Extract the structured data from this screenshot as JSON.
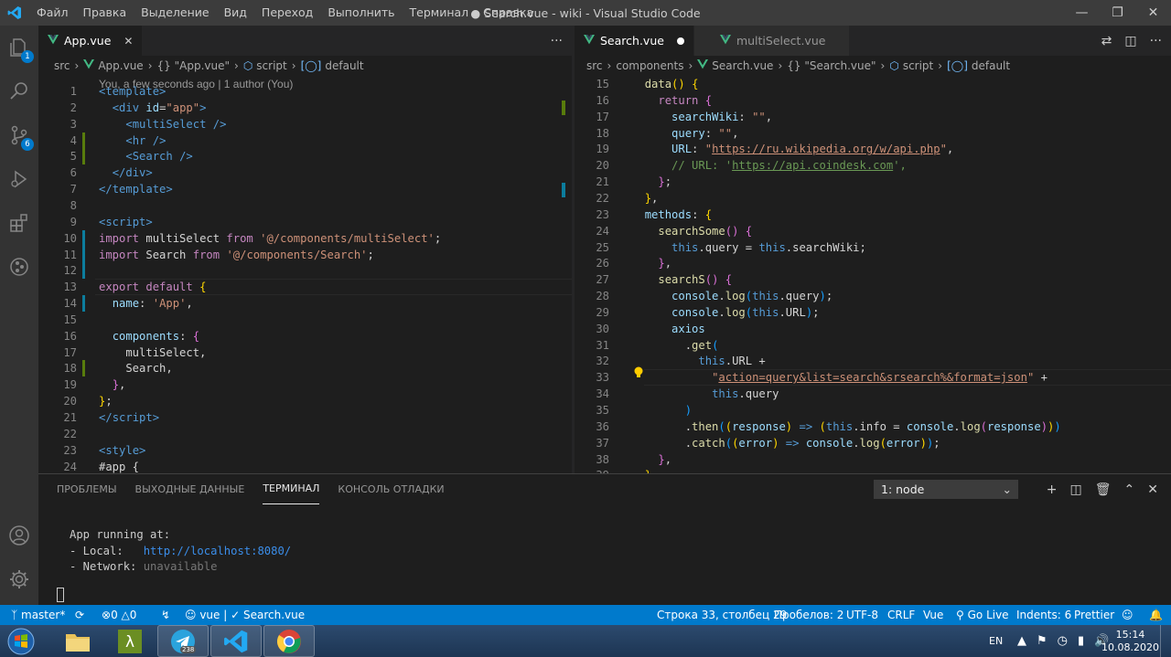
{
  "window": {
    "title": "● Search.vue - wiki - Visual Studio Code",
    "menu": [
      "Файл",
      "Правка",
      "Выделение",
      "Вид",
      "Переход",
      "Выполнить",
      "Терминал",
      "Справка"
    ]
  },
  "activitybar": {
    "explorer_badge": "1",
    "scm_badge": "6"
  },
  "left_editor": {
    "tab": {
      "label": "App.vue"
    },
    "breadcrumb": [
      "src",
      "App.vue",
      "{} \"App.vue\"",
      "script",
      "default"
    ],
    "codelens": "You, a few seconds ago | 1 author (You)",
    "line_numbers": [
      "1",
      "2",
      "3",
      "4",
      "5",
      "6",
      "7",
      "8",
      "9",
      "10",
      "11",
      "12",
      "13",
      "14",
      "15",
      "16",
      "17",
      "18",
      "19",
      "20",
      "21",
      "22",
      "23",
      "24"
    ],
    "lines": [
      [
        [
          "tg",
          "<"
        ],
        [
          "tg",
          "template"
        ],
        [
          "tg",
          ">"
        ]
      ],
      [
        [
          "tx",
          "  "
        ],
        [
          "tg",
          "<"
        ],
        [
          "tg",
          "div"
        ],
        [
          "tx",
          " "
        ],
        [
          "at",
          "id"
        ],
        [
          "tx",
          "="
        ],
        [
          "st",
          "\"app\""
        ],
        [
          "tg",
          ">"
        ]
      ],
      [
        [
          "tx",
          "    "
        ],
        [
          "tg",
          "<"
        ],
        [
          "tg",
          "multiSelect"
        ],
        [
          "tx",
          " "
        ],
        [
          "tg",
          "/>"
        ]
      ],
      [
        [
          "tx",
          "    "
        ],
        [
          "tg",
          "<"
        ],
        [
          "tg",
          "hr"
        ],
        [
          "tx",
          " "
        ],
        [
          "tg",
          "/>"
        ]
      ],
      [
        [
          "tx",
          "    "
        ],
        [
          "tg",
          "<"
        ],
        [
          "tg",
          "Search"
        ],
        [
          "tx",
          " "
        ],
        [
          "tg",
          "/>"
        ]
      ],
      [
        [
          "tx",
          "  "
        ],
        [
          "tg",
          "</"
        ],
        [
          "tg",
          "div"
        ],
        [
          "tg",
          ">"
        ]
      ],
      [
        [
          "tg",
          "</"
        ],
        [
          "tg",
          "template"
        ],
        [
          "tg",
          ">"
        ]
      ],
      [],
      [
        [
          "tg",
          "<"
        ],
        [
          "tg",
          "script"
        ],
        [
          "tg",
          ">"
        ]
      ],
      [
        [
          "kw",
          "import"
        ],
        [
          "tx",
          " multiSelect "
        ],
        [
          "kw",
          "from"
        ],
        [
          "tx",
          " "
        ],
        [
          "st",
          "'@/components/multiSelect'"
        ],
        [
          "tx",
          ";"
        ]
      ],
      [
        [
          "kw",
          "import"
        ],
        [
          "tx",
          " Search "
        ],
        [
          "kw",
          "from"
        ],
        [
          "tx",
          " "
        ],
        [
          "st",
          "'@/components/Search'"
        ],
        [
          "tx",
          ";"
        ]
      ],
      [],
      [
        [
          "kw",
          "export"
        ],
        [
          "tx",
          " "
        ],
        [
          "kw",
          "default"
        ],
        [
          "tx",
          " "
        ],
        [
          "gd",
          "{"
        ]
      ],
      [
        [
          "tx",
          "  "
        ],
        [
          "vr",
          "name"
        ],
        [
          "tx",
          ": "
        ],
        [
          "st",
          "'App'"
        ],
        [
          "tx",
          ","
        ]
      ],
      [],
      [
        [
          "tx",
          "  "
        ],
        [
          "vr",
          "components"
        ],
        [
          "tx",
          ": "
        ],
        [
          "pk",
          "{"
        ]
      ],
      [
        [
          "tx",
          "    multiSelect,"
        ]
      ],
      [
        [
          "tx",
          "    Search,"
        ]
      ],
      [
        [
          "tx",
          "  "
        ],
        [
          "pk",
          "}"
        ],
        [
          "tx",
          ","
        ]
      ],
      [
        [
          "gd",
          "}"
        ],
        [
          "tx",
          ";"
        ]
      ],
      [
        [
          "tg",
          "</"
        ],
        [
          "tg",
          "script"
        ],
        [
          "tg",
          ">"
        ]
      ],
      [],
      [
        [
          "tg",
          "<"
        ],
        [
          "tg",
          "style"
        ],
        [
          "tg",
          ">"
        ]
      ],
      [
        [
          "tx",
          "#app {"
        ]
      ]
    ]
  },
  "right_editor": {
    "tabs": [
      {
        "label": "Search.vue",
        "dirty": true
      },
      {
        "label": "multiSelect.vue"
      }
    ],
    "breadcrumb": [
      "src",
      "components",
      "Search.vue",
      "{} \"Search.vue\"",
      "script",
      "default"
    ],
    "line_numbers": [
      "15",
      "16",
      "17",
      "18",
      "19",
      "20",
      "21",
      "22",
      "23",
      "24",
      "25",
      "26",
      "27",
      "28",
      "29",
      "30",
      "31",
      "32",
      "33",
      "34",
      "35",
      "36",
      "37",
      "38",
      "39"
    ],
    "lines": [
      [
        [
          "tx",
          "  "
        ],
        [
          "fn",
          "data"
        ],
        [
          "gd",
          "()"
        ],
        [
          "tx",
          " "
        ],
        [
          "gd",
          "{"
        ]
      ],
      [
        [
          "tx",
          "    "
        ],
        [
          "kw",
          "return"
        ],
        [
          "tx",
          " "
        ],
        [
          "pk",
          "{"
        ]
      ],
      [
        [
          "tx",
          "      "
        ],
        [
          "vr",
          "searchWiki"
        ],
        [
          "tx",
          ": "
        ],
        [
          "st",
          "\"\""
        ],
        [
          "tx",
          ","
        ]
      ],
      [
        [
          "tx",
          "      "
        ],
        [
          "vr",
          "query"
        ],
        [
          "tx",
          ": "
        ],
        [
          "st",
          "\"\""
        ],
        [
          "tx",
          ","
        ]
      ],
      [
        [
          "tx",
          "      "
        ],
        [
          "vr",
          "URL"
        ],
        [
          "tx",
          ": "
        ],
        [
          "st",
          "\""
        ],
        [
          "stu",
          "https://ru.wikipedia.org/w/api.php"
        ],
        [
          "st",
          "\""
        ],
        [
          "tx",
          ","
        ]
      ],
      [
        [
          "tx",
          "      "
        ],
        [
          "cm",
          "// URL: '"
        ],
        [
          "cmu",
          "https://api.coindesk.com"
        ],
        [
          "cm",
          "',"
        ]
      ],
      [
        [
          "tx",
          "    "
        ],
        [
          "pk",
          "}"
        ],
        [
          "tx",
          ";"
        ]
      ],
      [
        [
          "tx",
          "  "
        ],
        [
          "gd",
          "}"
        ],
        [
          "tx",
          ","
        ]
      ],
      [
        [
          "tx",
          "  "
        ],
        [
          "vr",
          "methods"
        ],
        [
          "tx",
          ": "
        ],
        [
          "gd",
          "{"
        ]
      ],
      [
        [
          "tx",
          "    "
        ],
        [
          "fn",
          "searchSome"
        ],
        [
          "pk",
          "()"
        ],
        [
          "tx",
          " "
        ],
        [
          "pk",
          "{"
        ]
      ],
      [
        [
          "tx",
          "      "
        ],
        [
          "bl",
          "this"
        ],
        [
          "tx",
          ".query = "
        ],
        [
          "bl",
          "this"
        ],
        [
          "tx",
          ".searchWiki;"
        ]
      ],
      [
        [
          "tx",
          "    "
        ],
        [
          "pk",
          "}"
        ],
        [
          "tx",
          ","
        ]
      ],
      [
        [
          "tx",
          "    "
        ],
        [
          "fn",
          "searchS"
        ],
        [
          "pk",
          "()"
        ],
        [
          "tx",
          " "
        ],
        [
          "pk",
          "{"
        ]
      ],
      [
        [
          "tx",
          "      "
        ],
        [
          "vr",
          "console"
        ],
        [
          "tx",
          "."
        ],
        [
          "fn",
          "log"
        ],
        [
          "br",
          "("
        ],
        [
          "bl",
          "this"
        ],
        [
          "tx",
          ".query"
        ],
        [
          "br",
          ")"
        ],
        [
          "tx",
          ";"
        ]
      ],
      [
        [
          "tx",
          "      "
        ],
        [
          "vr",
          "console"
        ],
        [
          "tx",
          "."
        ],
        [
          "fn",
          "log"
        ],
        [
          "br",
          "("
        ],
        [
          "bl",
          "this"
        ],
        [
          "tx",
          ".URL"
        ],
        [
          "br",
          ")"
        ],
        [
          "tx",
          ";"
        ]
      ],
      [
        [
          "tx",
          "      "
        ],
        [
          "vr",
          "axios"
        ]
      ],
      [
        [
          "tx",
          "        ."
        ],
        [
          "fn",
          "get"
        ],
        [
          "br",
          "("
        ]
      ],
      [
        [
          "tx",
          "          "
        ],
        [
          "bl",
          "this"
        ],
        [
          "tx",
          ".URL +"
        ]
      ],
      [
        [
          "tx",
          "            "
        ],
        [
          "st",
          "\""
        ],
        [
          "stu",
          "action=query&list=search&srsearch%&format=json"
        ],
        [
          "st",
          "\""
        ],
        [
          "tx",
          " +"
        ]
      ],
      [
        [
          "tx",
          "            "
        ],
        [
          "bl",
          "this"
        ],
        [
          "tx",
          ".query"
        ]
      ],
      [
        [
          "tx",
          "        "
        ],
        [
          "br",
          ")"
        ]
      ],
      [
        [
          "tx",
          "        ."
        ],
        [
          "fn",
          "then"
        ],
        [
          "br",
          "("
        ],
        [
          "gd",
          "("
        ],
        [
          "vr",
          "response"
        ],
        [
          "gd",
          ")"
        ],
        [
          "tx",
          " "
        ],
        [
          "bl",
          "=>"
        ],
        [
          "tx",
          " "
        ],
        [
          "gd",
          "("
        ],
        [
          "bl",
          "this"
        ],
        [
          "tx",
          ".info = "
        ],
        [
          "vr",
          "console"
        ],
        [
          "tx",
          "."
        ],
        [
          "fn",
          "log"
        ],
        [
          "pk",
          "("
        ],
        [
          "vr",
          "response"
        ],
        [
          "pk",
          ")"
        ],
        [
          "gd",
          ")"
        ],
        [
          "br",
          ")"
        ]
      ],
      [
        [
          "tx",
          "        ."
        ],
        [
          "fn",
          "catch"
        ],
        [
          "br",
          "("
        ],
        [
          "gd",
          "("
        ],
        [
          "vr",
          "error"
        ],
        [
          "gd",
          ")"
        ],
        [
          "tx",
          " "
        ],
        [
          "bl",
          "=>"
        ],
        [
          "tx",
          " "
        ],
        [
          "vr",
          "console"
        ],
        [
          "tx",
          "."
        ],
        [
          "fn",
          "log"
        ],
        [
          "gd",
          "("
        ],
        [
          "vr",
          "error"
        ],
        [
          "gd",
          ")"
        ],
        [
          "br",
          ")"
        ],
        [
          "tx",
          ";"
        ]
      ],
      [
        [
          "tx",
          "    "
        ],
        [
          "pk",
          "}"
        ],
        [
          "tx",
          ","
        ]
      ],
      [
        [
          "tx",
          "  "
        ],
        [
          "gd",
          "}"
        ]
      ]
    ]
  },
  "panel": {
    "tabs": [
      "ПРОБЛЕМЫ",
      "ВЫХОДНЫЕ ДАННЫЕ",
      "ТЕРМИНАЛ",
      "КОНСОЛЬ ОТЛАДКИ"
    ],
    "active_tab": "ТЕРМИНАЛ",
    "terminal_select": "1: node",
    "terminal_line1": "App running at:",
    "terminal_local_label": "- Local:   ",
    "terminal_local_url": "http://localhost:8080/",
    "terminal_network_label": "- Network: ",
    "terminal_network_value": "unavailable"
  },
  "statusbar": {
    "branch": "master*",
    "errors": "0",
    "warnings": "0",
    "vue": "vue",
    "file": "✓ Search.vue",
    "position": "Строка 33, столбец 29",
    "spaces": "Пробелов: 2",
    "encoding": "UTF-8",
    "eol": "CRLF",
    "language": "Vue",
    "golive": "Go Live",
    "indents": "Indents: 6",
    "prettier": "Prettier"
  },
  "taskbar": {
    "telegram_badge": "238",
    "lang": "EN",
    "time": "15:14",
    "date": "10.08.2020"
  },
  "colors": {
    "accent": "#007acc",
    "titlebar": "#3c3c3c",
    "activitybar": "#333333",
    "editor_bg": "#1e1e1e",
    "vue_green": "#42b883"
  }
}
